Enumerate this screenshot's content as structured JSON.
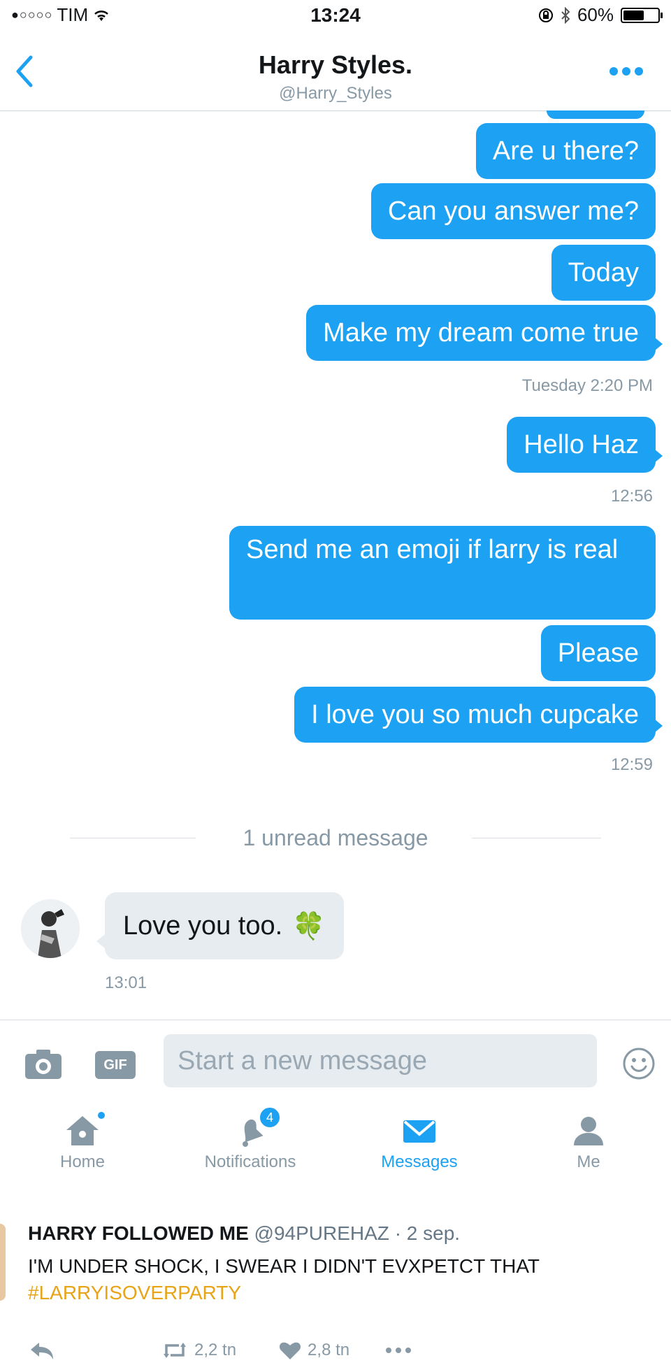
{
  "status_bar": {
    "carrier": "TIM",
    "signal": "●○○○○",
    "time": "13:24",
    "battery": "60%",
    "battery_level": 0.6
  },
  "header": {
    "title": "Harry Styles.",
    "handle": "@Harry_Styles"
  },
  "messages_out": [
    {
      "text": "Are u there?"
    },
    {
      "text": "Can you answer me?"
    },
    {
      "text": "Today"
    },
    {
      "text": "Make my dream come true"
    },
    {
      "text": "Hello Haz"
    },
    {
      "text": "Send me an emoji if larry is real"
    },
    {
      "text": "Please"
    },
    {
      "text": "I love you so much cupcake"
    }
  ],
  "timestamps": [
    "Tuesday 2:20 PM",
    "12:56",
    "12:59"
  ],
  "unread_divider": "1 unread message",
  "incoming": {
    "text": "Love you too.",
    "emoji": "🍀",
    "time": "13:01"
  },
  "compose": {
    "gif_label": "GIF",
    "placeholder": "Start a new message"
  },
  "tabs": [
    {
      "label": "Home"
    },
    {
      "label": "Notifications",
      "badge": "4"
    },
    {
      "label": "Messages"
    },
    {
      "label": "Me"
    }
  ],
  "tweet": {
    "name": "HARRY FOLLOWED ME",
    "meta": "@94PUREHAZ · 2 sep.",
    "body": "I'M UNDER SHOCK, I SWEAR I DIDN'T EVXPETCT THAT",
    "hashtag": "#LARRYISOVERPARTY",
    "retweets": "2,2 tn",
    "likes": "2,8 tn"
  },
  "colors": {
    "accent": "#1da1f2",
    "incoming_bubble": "#e6ecf0",
    "hashtag": "#e8a317"
  }
}
